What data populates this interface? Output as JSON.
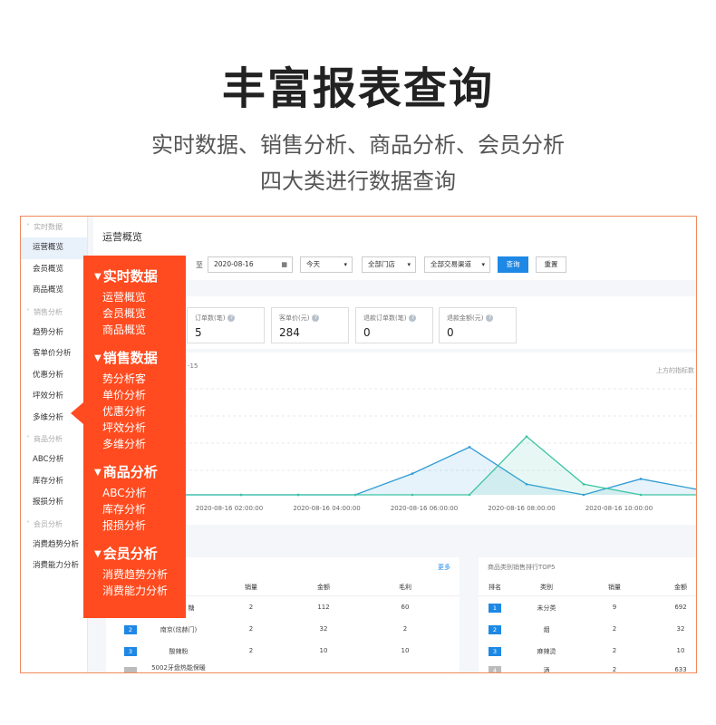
{
  "hero": {
    "title": "丰富报表查询",
    "subtitle_line1": "实时数据、销售分析、商品分析、会员分析",
    "subtitle_line2": "四大类进行数据查询"
  },
  "sidebar": {
    "groups": [
      {
        "label": "实时数据",
        "items": [
          "运营概览",
          "会员概览",
          "商品概览"
        ]
      },
      {
        "label": "销售分析",
        "items": [
          "趋势分析",
          "客单价分析",
          "优惠分析",
          "坪效分析",
          "多维分析"
        ]
      },
      {
        "label": "商品分析",
        "items": [
          "ABC分析",
          "库存分析",
          "报损分析"
        ]
      },
      {
        "label": "会员分析",
        "items": [
          "消费趋势分析",
          "消费能力分析"
        ]
      }
    ],
    "active_item": "运营概览"
  },
  "main": {
    "title": "运营概览",
    "filters": {
      "to_label": "至",
      "end_date": "2020-08-16",
      "period": "今天",
      "store": "全部门店",
      "channel": "全部交易渠道",
      "query_button": "查询",
      "reset_button": "重置"
    },
    "stats": [
      {
        "label": "订单数(笔)",
        "value": "5"
      },
      {
        "label": "客单价(元)",
        "value": "284"
      },
      {
        "label": "退款订单数(笔)",
        "value": "0"
      },
      {
        "label": "退款金额(元)",
        "value": "0"
      }
    ],
    "chart_date_fragment": "-15",
    "chart_note": "上方的指标数"
  },
  "chart_data": {
    "type": "line",
    "x": [
      "2020-08-16 02:00:00",
      "2020-08-16 04:00:00",
      "2020-08-16 06:00:00",
      "2020-08-16 08:00:00",
      "2020-08-16 10:00:00",
      "2020"
    ],
    "series": [
      {
        "color": "#2f9bd6",
        "values": [
          0,
          0,
          0,
          0,
          0.2,
          0.45,
          0.1,
          0,
          0.15,
          0.05
        ]
      },
      {
        "color": "#3cc4a3",
        "values": [
          0,
          0,
          0,
          0,
          0,
          0,
          0.55,
          0.1,
          0,
          0
        ]
      }
    ],
    "grid": true
  },
  "table_left": {
    "more_label": "更多",
    "headers": [
      "销量",
      "金额",
      "毛利"
    ],
    "rows": [
      {
        "rank": "",
        "name": "糖",
        "qty": "2",
        "amount": "112",
        "profit": "60"
      },
      {
        "rank": "2",
        "name": "南京(炫赫门)",
        "qty": "2",
        "amount": "32",
        "profit": "2"
      },
      {
        "rank": "3",
        "name": "酸辣粉",
        "qty": "2",
        "amount": "10",
        "profit": "10"
      },
      {
        "rank": "",
        "name": "5002牙盘热能保暖",
        "qty": "",
        "amount": "",
        "profit": ""
      }
    ]
  },
  "table_right": {
    "title": "商品类别销售排行TOP5",
    "headers": [
      "排名",
      "类别",
      "销量",
      "金额"
    ],
    "rows": [
      {
        "rank": "1",
        "category": "未分类",
        "qty": "9",
        "amount": "692"
      },
      {
        "rank": "2",
        "category": "烟",
        "qty": "2",
        "amount": "32"
      },
      {
        "rank": "3",
        "category": "麻辣烫",
        "qty": "2",
        "amount": "10"
      },
      {
        "rank": "4",
        "category": "酒",
        "qty": "2",
        "amount": "633"
      }
    ]
  },
  "overlay": {
    "sections": [
      {
        "title": "实时数据",
        "items": [
          "运营概览",
          "会员概览",
          "商品概览"
        ]
      },
      {
        "title": "销售数据",
        "items": [
          "势分析客",
          "单价分析",
          "优惠分析",
          "坪效分析",
          "多维分析"
        ]
      },
      {
        "title": "商品分析",
        "items": [
          "ABC分析",
          "库存分析",
          "报损分析"
        ]
      },
      {
        "title": "会员分析",
        "items": [
          "消费趋势分析",
          "消费能力分析"
        ]
      }
    ],
    "color": "#ff4b1f"
  }
}
